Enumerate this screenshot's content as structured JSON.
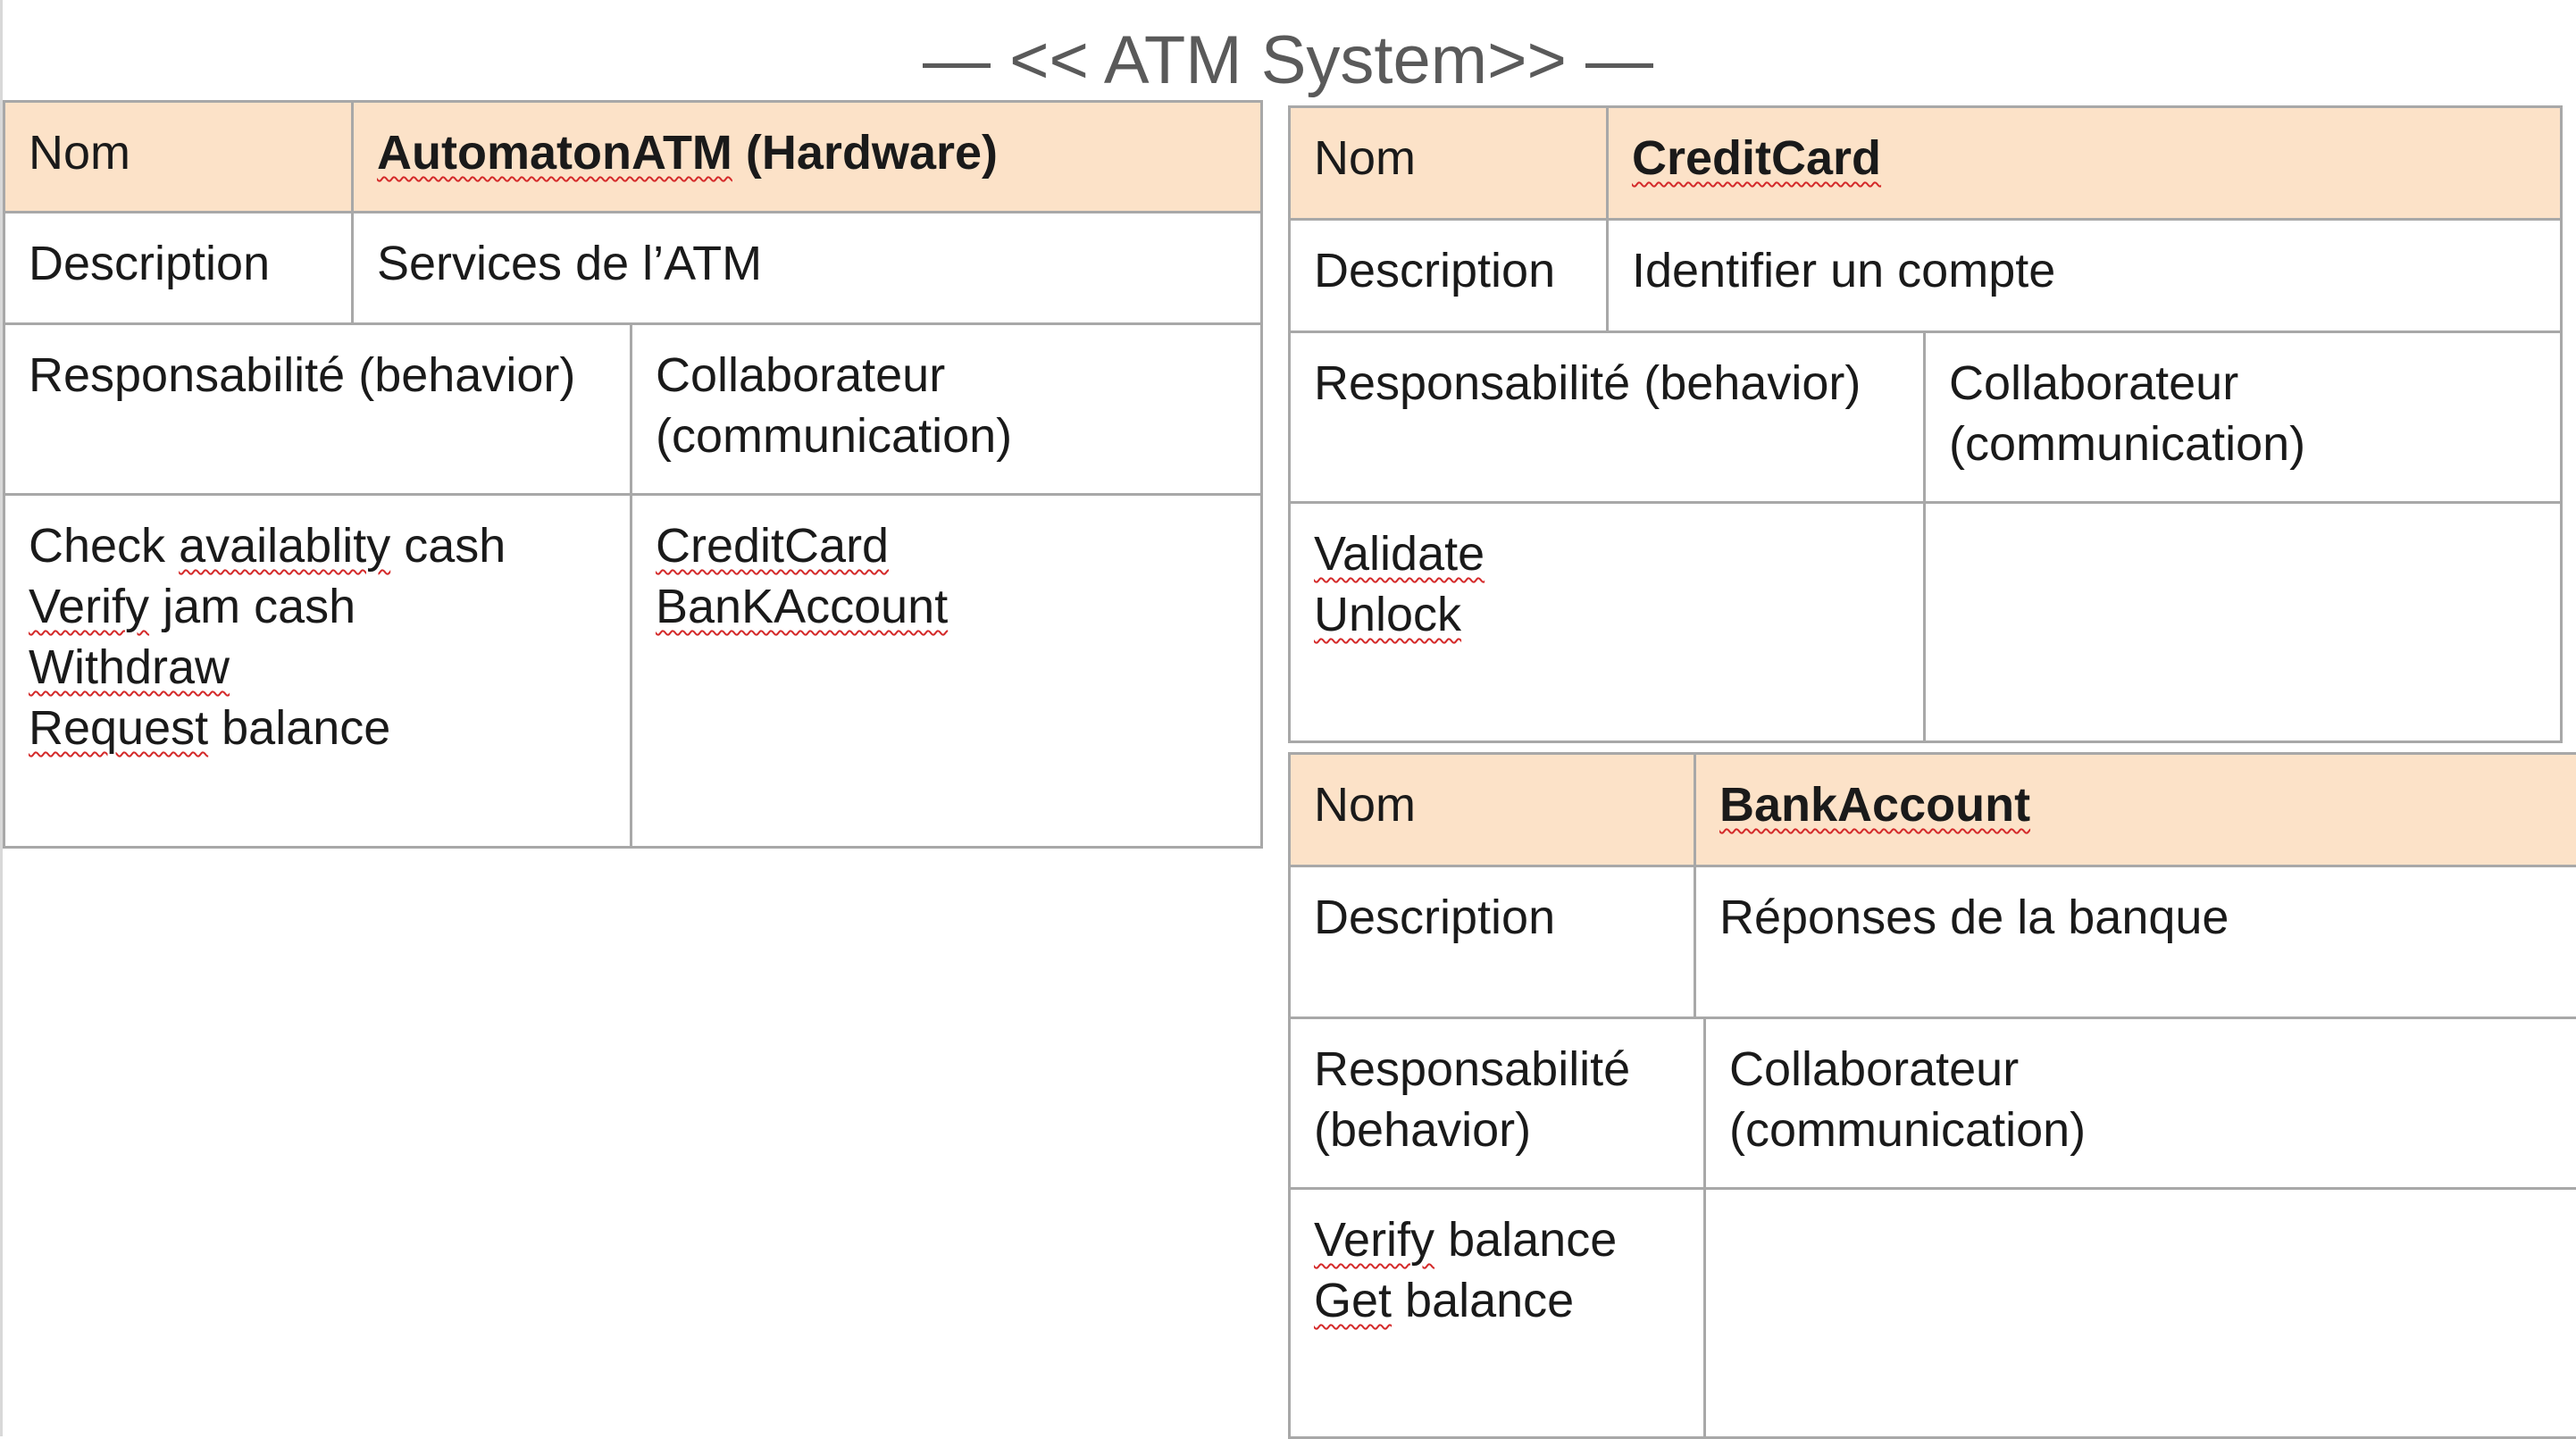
{
  "title": "— << ATM System>> —",
  "cards": [
    {
      "nom_label": "Nom",
      "name": "AutomatonATM (Hardware)",
      "description_label": "Description",
      "description": "Services de l’ATM",
      "responsibility_label": "Responsabilité (behavior)",
      "collaborator_label_1": "Collaborateur",
      "collaborator_label_2": "(communication)",
      "responsibilities": [
        "Check availablity cash",
        "Verify jam cash",
        "Withdraw",
        "Request balance"
      ],
      "collaborators": [
        "CreditCard",
        "BanKAccount"
      ]
    },
    {
      "nom_label": "Nom",
      "name": "CreditCard",
      "description_label": "Description",
      "description": "Identifier un compte",
      "responsibility_label": "Responsabilité (behavior)",
      "collaborator_label_1": "Collaborateur",
      "collaborator_label_2": "(communication)",
      "responsibilities": [
        "Validate",
        "Unlock"
      ],
      "collaborators": []
    },
    {
      "nom_label": "Nom",
      "name": "BankAccount",
      "description_label": "Description",
      "description": "Réponses de la banque",
      "responsibility_label": "Responsabilité (behavior)",
      "collaborator_label_1": "Collaborateur",
      "collaborator_label_2": "(communication)",
      "responsibilities": [
        "Verify balance",
        "Get balance"
      ],
      "collaborators": []
    }
  ]
}
